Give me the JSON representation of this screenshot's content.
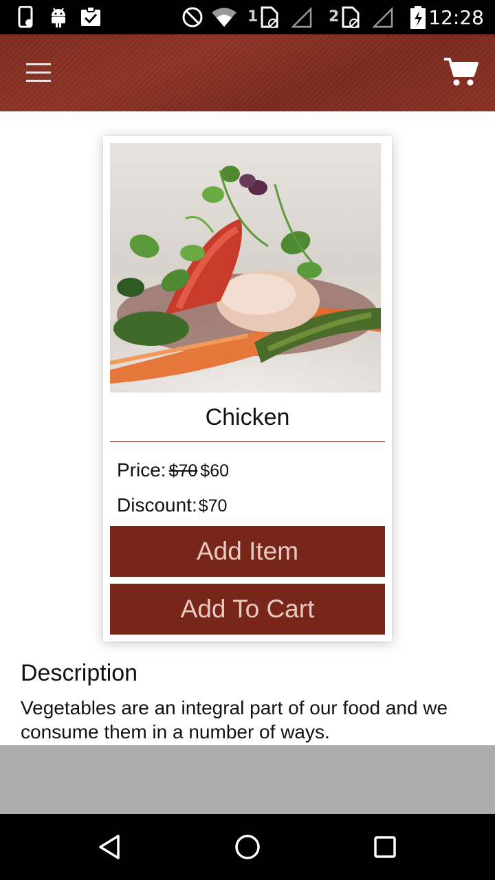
{
  "status_bar": {
    "time": "12:28",
    "sim1": "1",
    "sim2": "2",
    "icons": [
      "phone-icon",
      "android-icon",
      "clipboard-check-icon",
      "do-not-disturb-icon",
      "wifi-icon",
      "sim-card-icon",
      "signal-icon",
      "battery-icon"
    ]
  },
  "app_bar": {
    "menu_icon": "hamburger-menu-icon",
    "cart_icon": "shopping-cart-icon",
    "color": "#7e2a1e"
  },
  "product": {
    "name": "Chicken",
    "price_label": "Price:",
    "old_price": "$70",
    "new_price": "$60",
    "discount_label": "Discount:",
    "discount_value": "$70",
    "add_item_label": "Add Item",
    "add_to_cart_label": "Add To Cart",
    "button_color": "#79261a"
  },
  "description": {
    "title": "Description",
    "text": "Vegetables are an integral part of our food and we consume them in a number of ways."
  },
  "nav_bar": {
    "icons": [
      "back-icon",
      "home-icon",
      "recents-icon"
    ]
  }
}
